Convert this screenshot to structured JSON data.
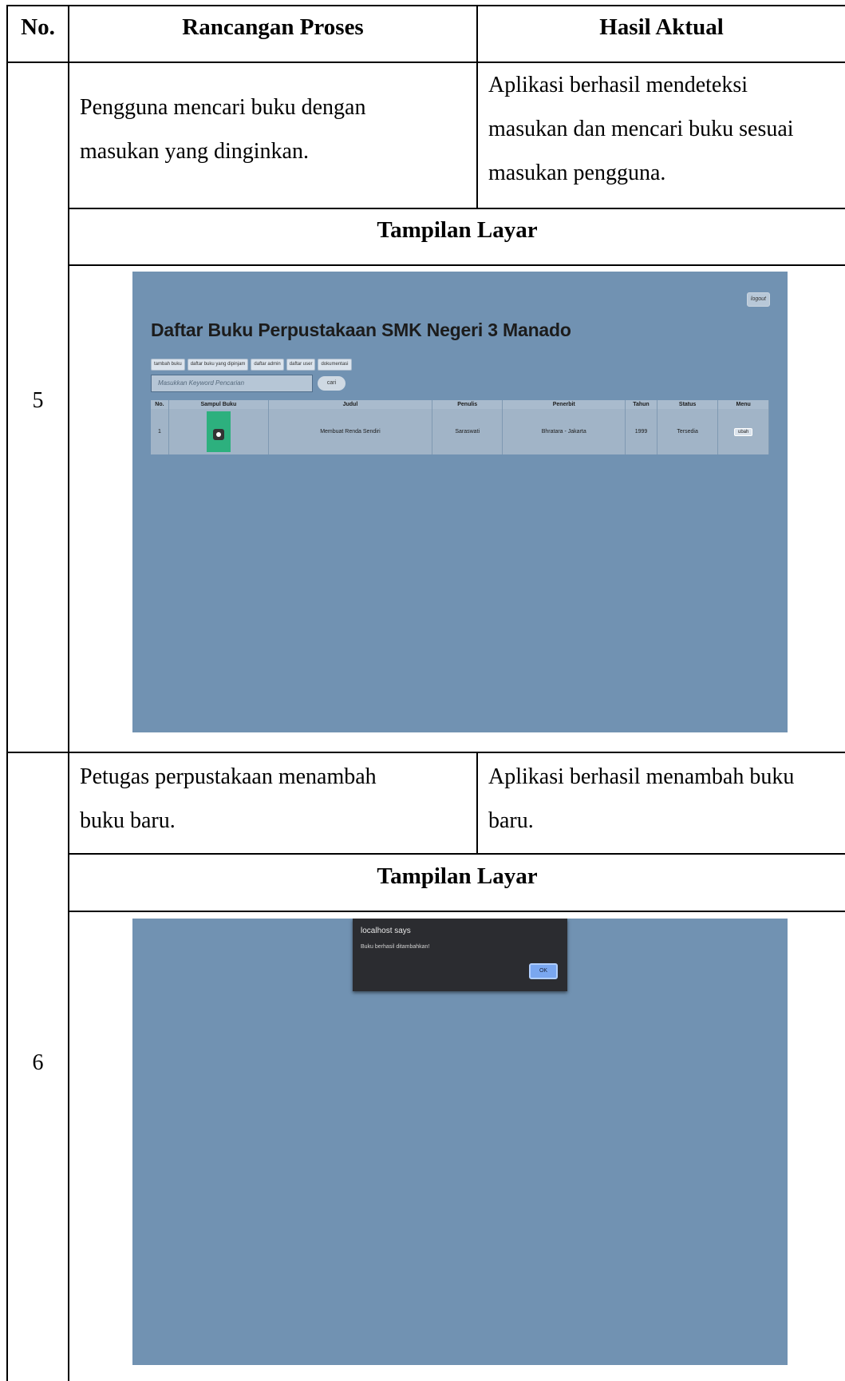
{
  "header": {
    "no": "No.",
    "rancangan": "Rancangan Proses",
    "hasil": "Hasil Aktual"
  },
  "rows": [
    {
      "number": "5",
      "rancangan": [
        "Pengguna mencari buku dengan",
        "masukan yang dinginkan."
      ],
      "hasil": [
        "Aplikasi berhasil mendeteksi",
        "masukan dan mencari buku sesuai",
        "masukan pengguna."
      ],
      "tampilan": "Tampilan Layar"
    },
    {
      "number": "6",
      "rancangan": [
        "Petugas perpustakaan menambah",
        "buku baru."
      ],
      "hasil": [
        "Aplikasi berhasil menambah buku",
        "baru."
      ],
      "tampilan": "Tampilan Layar"
    }
  ],
  "screenshot1": {
    "logout": "logout",
    "title": "Daftar Buku Perpustakaan SMK Negeri 3 Manado",
    "nav": [
      "tambah buku",
      "daftar buku yang dipinjam",
      "daftar admin",
      "daftar user",
      "dokumentasi"
    ],
    "search_placeholder": "Masukkan Keyword Pencarian",
    "search_button": "cari",
    "columns": [
      "No.",
      "Sampul Buku",
      "Judul",
      "Penulis",
      "Penerbit",
      "Tahun",
      "Status",
      "Menu"
    ],
    "row": {
      "no": "1",
      "judul": "Membuat Renda Sendiri",
      "penulis": "Saraswati",
      "penerbit": "Bhratara - Jakarta",
      "tahun": "1999",
      "status": "Tersedia",
      "menu": "ubah"
    },
    "background_color": "#7192b2"
  },
  "screenshot2": {
    "dialog_title": "localhost says",
    "dialog_message": "Buku berhasil ditambahkan!",
    "ok_label": "OK",
    "background_color": "#7192b2"
  }
}
